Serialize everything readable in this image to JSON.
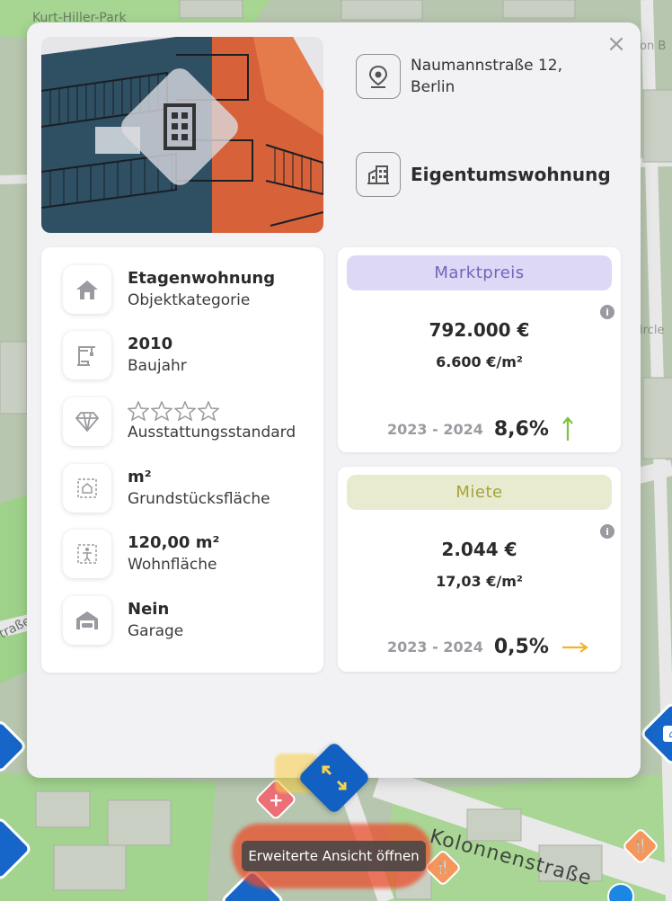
{
  "map": {
    "labels": {
      "top": "Kurt-Hiller-Park",
      "right1": "on B",
      "right2": "ircle",
      "left": "traße",
      "street": "Kolonnenstraße"
    },
    "tooltip": "Erweiterte Ansicht öffnen"
  },
  "property": {
    "address": [
      "Naumannstraße 12,",
      "Berlin"
    ],
    "type": "Eigentumswohnung",
    "details": [
      {
        "value": "Etagenwohnung",
        "label": "Objektkategorie",
        "icon": "house-icon"
      },
      {
        "value": "2010",
        "label": "Baujahr",
        "icon": "crane-icon"
      },
      {
        "value": "",
        "label": "Ausstattungsstandard",
        "icon": "diamond-icon",
        "stars_filled": 0,
        "stars_total": 4
      },
      {
        "value": "m²",
        "label": "Grundstücksfläche",
        "icon": "plot-area-icon"
      },
      {
        "value": "120,00 m²",
        "label": "Wohnfläche",
        "icon": "living-area-icon"
      },
      {
        "value": "Nein",
        "label": "Garage",
        "icon": "garage-icon"
      }
    ]
  },
  "market": {
    "title": "Marktpreis",
    "price": "792.000 €",
    "per_sqm": "6.600 €/m²",
    "period": "2023 - 2024",
    "change": "8,6%",
    "trend": "up",
    "trend_color": "#7cc142",
    "tag_color": "#dcd8f6"
  },
  "rent": {
    "title": "Miete",
    "price": "2.044 €",
    "per_sqm": "17,03 €/m²",
    "period": "2023 - 2024",
    "change": "0,5%",
    "trend": "flat",
    "trend_color": "#f2b52a",
    "tag_color": "#e9ebd1"
  },
  "info_icon": "i",
  "close_icon": "×"
}
